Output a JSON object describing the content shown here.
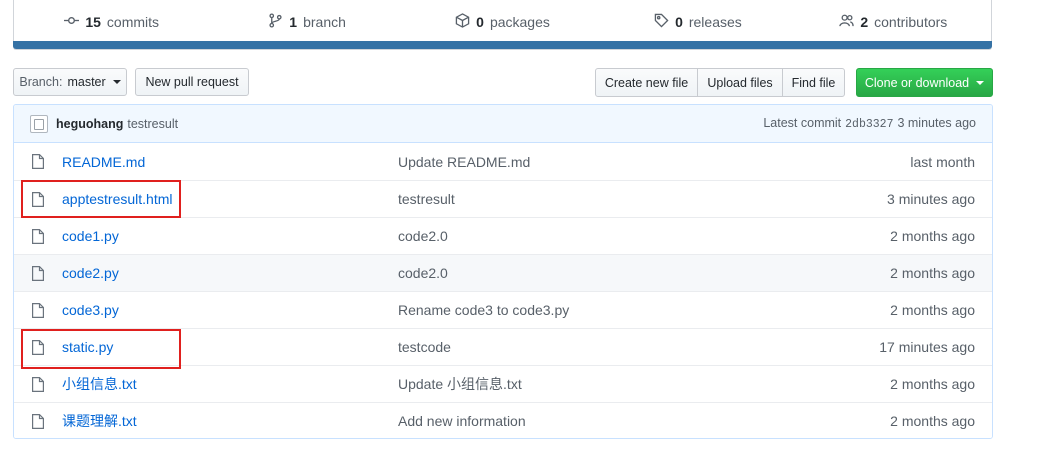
{
  "summary": {
    "commits": {
      "num": "15",
      "label": "commits"
    },
    "branches": {
      "num": "1",
      "label": "branch"
    },
    "packages": {
      "num": "0",
      "label": "packages"
    },
    "releases": {
      "num": "0",
      "label": "releases"
    },
    "contributors": {
      "num": "2",
      "label": "contributors"
    },
    "language_color": "#3572A5"
  },
  "toolbar": {
    "branch_prefix": "Branch:",
    "branch_name": "master",
    "new_pr": "New pull request",
    "create_file": "Create new file",
    "upload_files": "Upload files",
    "find_file": "Find file",
    "clone": "Clone or download"
  },
  "latest_commit": {
    "author": "heguohang",
    "message": "testresult",
    "prefix": "Latest commit",
    "sha": "2db3327",
    "age": "3 minutes ago"
  },
  "files": [
    {
      "name": "README.md",
      "message": "Update README.md",
      "age": "last month"
    },
    {
      "name": "apptestresult.html",
      "message": "testresult",
      "age": "3 minutes ago"
    },
    {
      "name": "code1.py",
      "message": "code2.0",
      "age": "2 months ago"
    },
    {
      "name": "code2.py",
      "message": "code2.0",
      "age": "2 months ago"
    },
    {
      "name": "code3.py",
      "message": "Rename code3 to code3.py",
      "age": "2 months ago"
    },
    {
      "name": "static.py",
      "message": "testcode",
      "age": "17 minutes ago"
    },
    {
      "name": "小组信息.txt",
      "message": "Update 小组信息.txt",
      "age": "2 months ago"
    },
    {
      "name": "课题理解.txt",
      "message": "Add new information",
      "age": "2 months ago"
    }
  ],
  "colors": {
    "link": "#0366d6",
    "highlight": "#e0201e",
    "clone_button": "#28a745"
  }
}
